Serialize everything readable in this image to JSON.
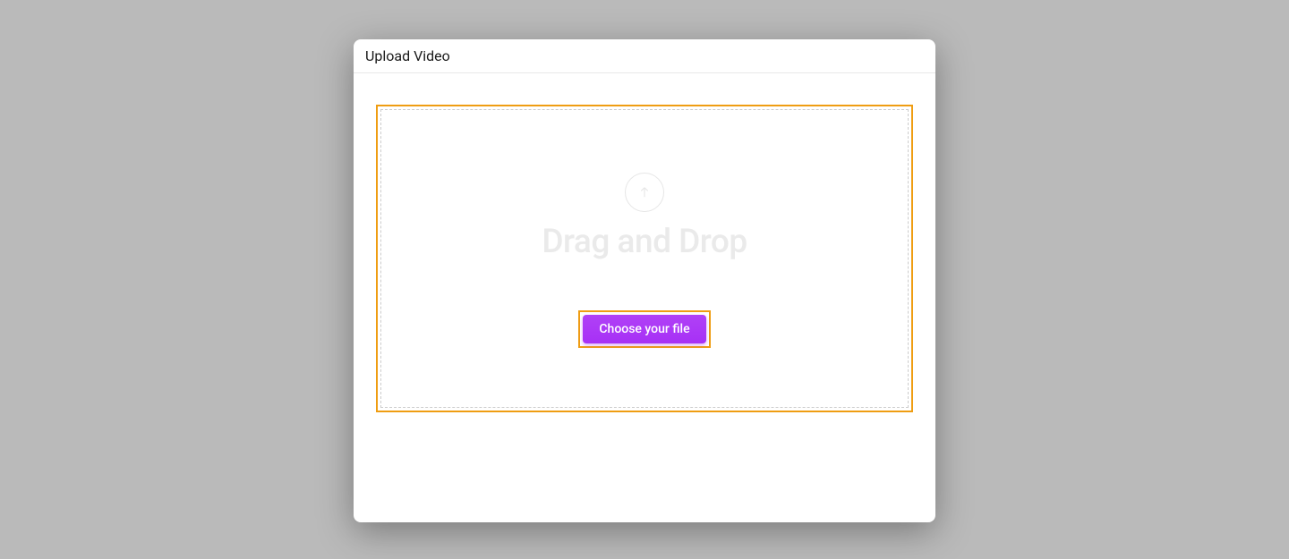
{
  "modal": {
    "title": "Upload Video",
    "dropzone_text": "Drag and Drop",
    "choose_file_label": "Choose your file"
  }
}
